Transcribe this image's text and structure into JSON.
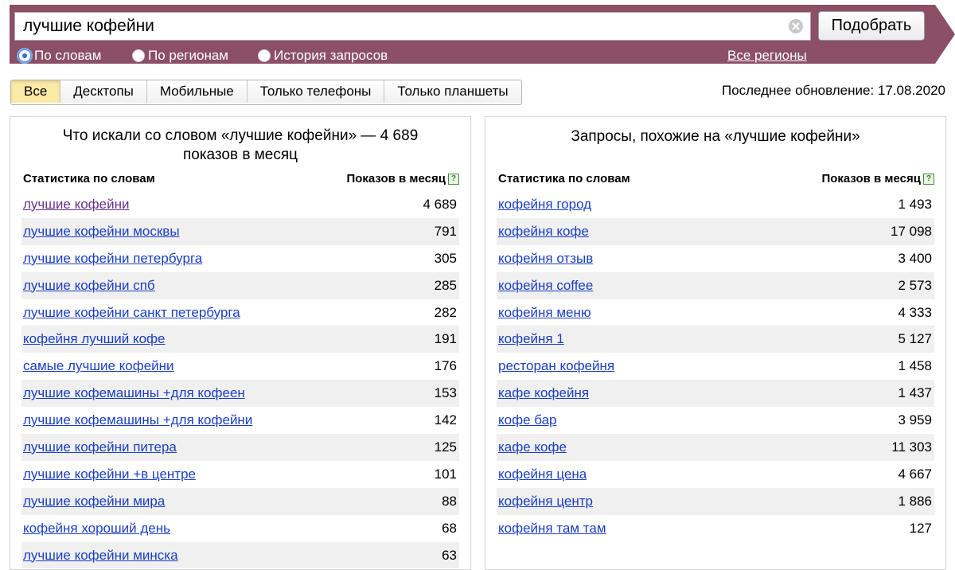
{
  "search": {
    "query": "лучшие кофейни",
    "submit_label": "Подобрать"
  },
  "search_modes": [
    {
      "label": "По словам",
      "checked": true
    },
    {
      "label": "По регионам",
      "checked": false
    },
    {
      "label": "История запросов",
      "checked": false
    }
  ],
  "regions_link": "Все регионы",
  "device_tabs": [
    {
      "label": "Все",
      "active": true
    },
    {
      "label": "Десктопы",
      "active": false
    },
    {
      "label": "Мобильные",
      "active": false
    },
    {
      "label": "Только телефоны",
      "active": false
    },
    {
      "label": "Только планшеты",
      "active": false
    }
  ],
  "last_update": "Последнее обновление: 17.08.2020",
  "left_panel": {
    "title_line1": "Что искали со словом «лучшие кофейни» — 4 689",
    "title_line2": "показов в месяц",
    "col_phrase": "Статистика по словам",
    "col_count": "Показов в месяц",
    "rows": [
      {
        "phrase": "лучшие кофейни",
        "count": "4 689",
        "visited": true
      },
      {
        "phrase": "лучшие кофейни москвы",
        "count": "791"
      },
      {
        "phrase": "лучшие кофейни петербурга",
        "count": "305"
      },
      {
        "phrase": "лучшие кофейни спб",
        "count": "285"
      },
      {
        "phrase": "лучшие кофейни санкт петербурга",
        "count": "282"
      },
      {
        "phrase": "кофейня лучший кофе",
        "count": "191"
      },
      {
        "phrase": "самые лучшие кофейни",
        "count": "176"
      },
      {
        "phrase": "лучшие кофемашины +для кофеен",
        "count": "153"
      },
      {
        "phrase": "лучшие кофемашины +для кофейни",
        "count": "142"
      },
      {
        "phrase": "лучшие кофейни питера",
        "count": "125"
      },
      {
        "phrase": "лучшие кофейни +в центре",
        "count": "101"
      },
      {
        "phrase": "лучшие кофейни мира",
        "count": "88"
      },
      {
        "phrase": "кофейня хороший день",
        "count": "68"
      },
      {
        "phrase": "лучшие кофейни минска",
        "count": "63"
      }
    ]
  },
  "right_panel": {
    "title_line1": "Запросы, похожие на «лучшие кофейни»",
    "col_phrase": "Статистика по словам",
    "col_count": "Показов в месяц",
    "rows": [
      {
        "phrase": "кофейня город",
        "count": "1 493"
      },
      {
        "phrase": "кофейня кофе",
        "count": "17 098"
      },
      {
        "phrase": "кофейня отзыв",
        "count": "3 400"
      },
      {
        "phrase": "кофейня coffee",
        "count": "2 573"
      },
      {
        "phrase": "кофейня меню",
        "count": "4 333"
      },
      {
        "phrase": "кофейня 1",
        "count": "5 127"
      },
      {
        "phrase": "ресторан кофейня",
        "count": "1 458"
      },
      {
        "phrase": "кафе кофейня",
        "count": "1 437"
      },
      {
        "phrase": "кофе бар",
        "count": "3 959"
      },
      {
        "phrase": "кафе кофе",
        "count": "11 303"
      },
      {
        "phrase": "кофейня цена",
        "count": "4 667"
      },
      {
        "phrase": "кофейня центр",
        "count": "1 886"
      },
      {
        "phrase": "кофейня там там",
        "count": "127"
      }
    ]
  },
  "colors": {
    "header_bg": "#8b4f66",
    "link": "#1a3ec1",
    "visited_link": "#6b2f8e",
    "active_tab": "#fbe9a6",
    "row_alt": "#f0f0f0"
  }
}
